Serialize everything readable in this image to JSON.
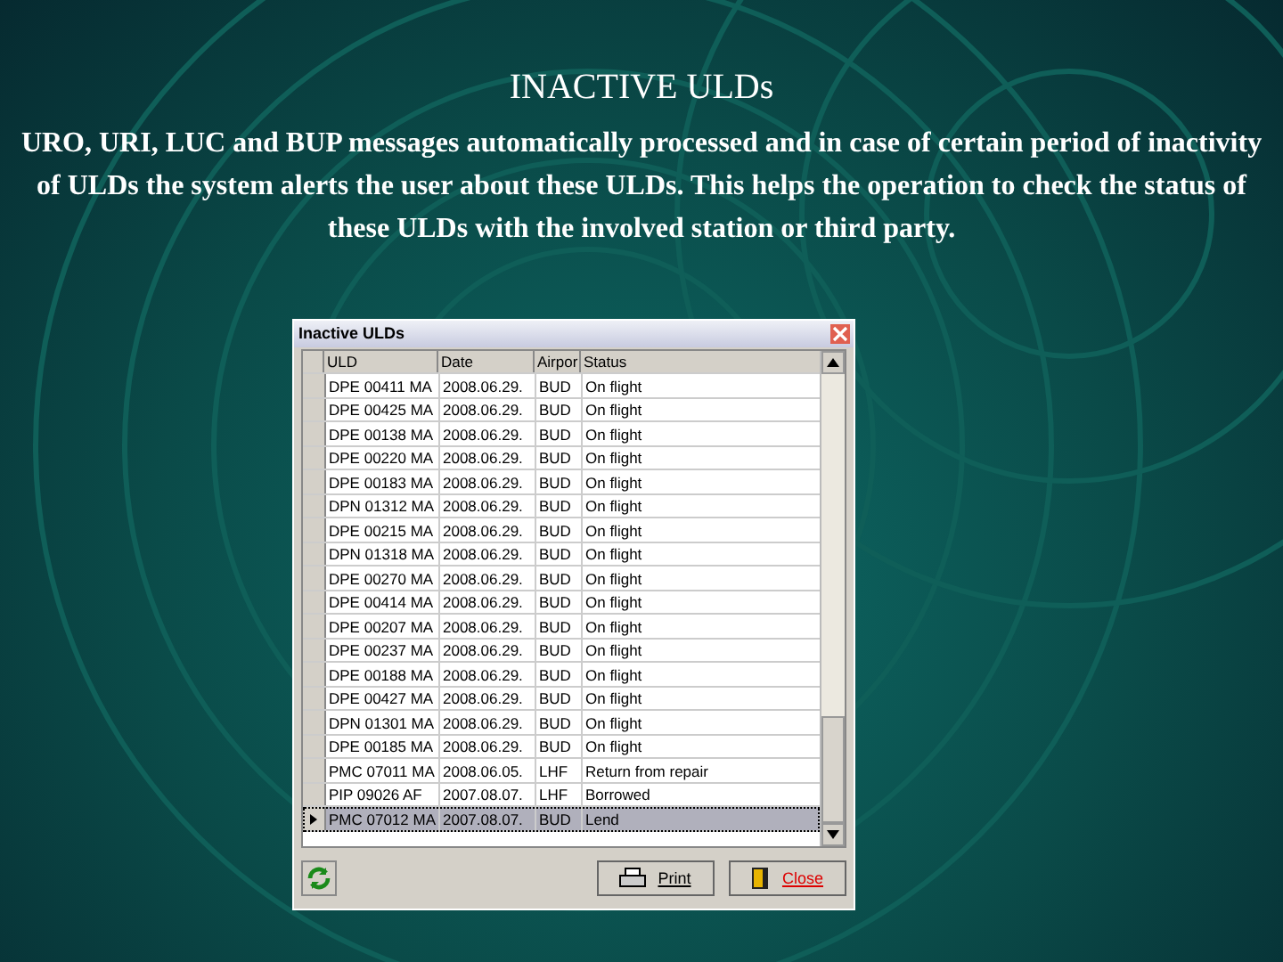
{
  "slide": {
    "title": "INACTIVE ULDs",
    "text": "URO, URI, LUC and BUP messages automatically processed and in case of certain period of inactivity of ULDs the system alerts the user about these ULDs. This helps the operation to check the status of these ULDs with the involved station or third party."
  },
  "window": {
    "title": "Inactive ULDs",
    "table": {
      "columns": [
        "ULD",
        "Date",
        "Airpor",
        "Status"
      ],
      "rows": [
        {
          "cells": [
            "DPE 00411 MA",
            "2008.06.29.",
            "BUD",
            "On flight"
          ],
          "selected": false
        },
        {
          "cells": [
            "DPE 00425 MA",
            "2008.06.29.",
            "BUD",
            "On flight"
          ],
          "selected": false
        },
        {
          "cells": [
            "DPE 00138 MA",
            "2008.06.29.",
            "BUD",
            "On flight"
          ],
          "selected": false
        },
        {
          "cells": [
            "DPE 00220 MA",
            "2008.06.29.",
            "BUD",
            "On flight"
          ],
          "selected": false
        },
        {
          "cells": [
            "DPE 00183 MA",
            "2008.06.29.",
            "BUD",
            "On flight"
          ],
          "selected": false
        },
        {
          "cells": [
            "DPN 01312 MA",
            "2008.06.29.",
            "BUD",
            "On flight"
          ],
          "selected": false
        },
        {
          "cells": [
            "DPE 00215 MA",
            "2008.06.29.",
            "BUD",
            "On flight"
          ],
          "selected": false
        },
        {
          "cells": [
            "DPN 01318 MA",
            "2008.06.29.",
            "BUD",
            "On flight"
          ],
          "selected": false
        },
        {
          "cells": [
            "DPE 00270 MA",
            "2008.06.29.",
            "BUD",
            "On flight"
          ],
          "selected": false
        },
        {
          "cells": [
            "DPE 00414 MA",
            "2008.06.29.",
            "BUD",
            "On flight"
          ],
          "selected": false
        },
        {
          "cells": [
            "DPE 00207 MA",
            "2008.06.29.",
            "BUD",
            "On flight"
          ],
          "selected": false
        },
        {
          "cells": [
            "DPE 00237 MA",
            "2008.06.29.",
            "BUD",
            "On flight"
          ],
          "selected": false
        },
        {
          "cells": [
            "DPE 00188 MA",
            "2008.06.29.",
            "BUD",
            "On flight"
          ],
          "selected": false
        },
        {
          "cells": [
            "DPE 00427 MA",
            "2008.06.29.",
            "BUD",
            "On flight"
          ],
          "selected": false
        },
        {
          "cells": [
            "DPN 01301 MA",
            "2008.06.29.",
            "BUD",
            "On flight"
          ],
          "selected": false
        },
        {
          "cells": [
            "DPE 00185 MA",
            "2008.06.29.",
            "BUD",
            "On flight"
          ],
          "selected": false
        },
        {
          "cells": [
            "PMC 07011 MA",
            "2008.06.05.",
            "LHF",
            "Return from repair"
          ],
          "selected": false
        },
        {
          "cells": [
            "PIP 09026 AF",
            "2007.08.07.",
            "LHF",
            "Borrowed"
          ],
          "selected": false
        },
        {
          "cells": [
            "PMC 07012 MA",
            "2007.08.07.",
            "BUD",
            "Lend"
          ],
          "selected": true
        }
      ]
    },
    "buttons": [
      {
        "label": "Print",
        "kind": "print"
      },
      {
        "label": "Close",
        "kind": "close"
      }
    ]
  }
}
